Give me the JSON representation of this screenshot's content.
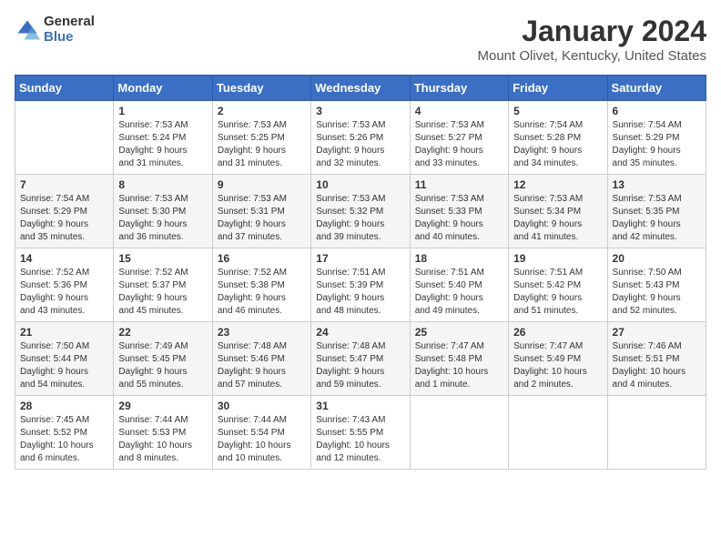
{
  "logo": {
    "general": "General",
    "blue": "Blue"
  },
  "calendar": {
    "title": "January 2024",
    "subtitle": "Mount Olivet, Kentucky, United States"
  },
  "headers": [
    "Sunday",
    "Monday",
    "Tuesday",
    "Wednesday",
    "Thursday",
    "Friday",
    "Saturday"
  ],
  "weeks": [
    [
      {
        "day": "",
        "info": ""
      },
      {
        "day": "1",
        "info": "Sunrise: 7:53 AM\nSunset: 5:24 PM\nDaylight: 9 hours\nand 31 minutes."
      },
      {
        "day": "2",
        "info": "Sunrise: 7:53 AM\nSunset: 5:25 PM\nDaylight: 9 hours\nand 31 minutes."
      },
      {
        "day": "3",
        "info": "Sunrise: 7:53 AM\nSunset: 5:26 PM\nDaylight: 9 hours\nand 32 minutes."
      },
      {
        "day": "4",
        "info": "Sunrise: 7:53 AM\nSunset: 5:27 PM\nDaylight: 9 hours\nand 33 minutes."
      },
      {
        "day": "5",
        "info": "Sunrise: 7:54 AM\nSunset: 5:28 PM\nDaylight: 9 hours\nand 34 minutes."
      },
      {
        "day": "6",
        "info": "Sunrise: 7:54 AM\nSunset: 5:29 PM\nDaylight: 9 hours\nand 35 minutes."
      }
    ],
    [
      {
        "day": "7",
        "info": "Sunrise: 7:54 AM\nSunset: 5:29 PM\nDaylight: 9 hours\nand 35 minutes."
      },
      {
        "day": "8",
        "info": "Sunrise: 7:53 AM\nSunset: 5:30 PM\nDaylight: 9 hours\nand 36 minutes."
      },
      {
        "day": "9",
        "info": "Sunrise: 7:53 AM\nSunset: 5:31 PM\nDaylight: 9 hours\nand 37 minutes."
      },
      {
        "day": "10",
        "info": "Sunrise: 7:53 AM\nSunset: 5:32 PM\nDaylight: 9 hours\nand 39 minutes."
      },
      {
        "day": "11",
        "info": "Sunrise: 7:53 AM\nSunset: 5:33 PM\nDaylight: 9 hours\nand 40 minutes."
      },
      {
        "day": "12",
        "info": "Sunrise: 7:53 AM\nSunset: 5:34 PM\nDaylight: 9 hours\nand 41 minutes."
      },
      {
        "day": "13",
        "info": "Sunrise: 7:53 AM\nSunset: 5:35 PM\nDaylight: 9 hours\nand 42 minutes."
      }
    ],
    [
      {
        "day": "14",
        "info": "Sunrise: 7:52 AM\nSunset: 5:36 PM\nDaylight: 9 hours\nand 43 minutes."
      },
      {
        "day": "15",
        "info": "Sunrise: 7:52 AM\nSunset: 5:37 PM\nDaylight: 9 hours\nand 45 minutes."
      },
      {
        "day": "16",
        "info": "Sunrise: 7:52 AM\nSunset: 5:38 PM\nDaylight: 9 hours\nand 46 minutes."
      },
      {
        "day": "17",
        "info": "Sunrise: 7:51 AM\nSunset: 5:39 PM\nDaylight: 9 hours\nand 48 minutes."
      },
      {
        "day": "18",
        "info": "Sunrise: 7:51 AM\nSunset: 5:40 PM\nDaylight: 9 hours\nand 49 minutes."
      },
      {
        "day": "19",
        "info": "Sunrise: 7:51 AM\nSunset: 5:42 PM\nDaylight: 9 hours\nand 51 minutes."
      },
      {
        "day": "20",
        "info": "Sunrise: 7:50 AM\nSunset: 5:43 PM\nDaylight: 9 hours\nand 52 minutes."
      }
    ],
    [
      {
        "day": "21",
        "info": "Sunrise: 7:50 AM\nSunset: 5:44 PM\nDaylight: 9 hours\nand 54 minutes."
      },
      {
        "day": "22",
        "info": "Sunrise: 7:49 AM\nSunset: 5:45 PM\nDaylight: 9 hours\nand 55 minutes."
      },
      {
        "day": "23",
        "info": "Sunrise: 7:48 AM\nSunset: 5:46 PM\nDaylight: 9 hours\nand 57 minutes."
      },
      {
        "day": "24",
        "info": "Sunrise: 7:48 AM\nSunset: 5:47 PM\nDaylight: 9 hours\nand 59 minutes."
      },
      {
        "day": "25",
        "info": "Sunrise: 7:47 AM\nSunset: 5:48 PM\nDaylight: 10 hours\nand 1 minute."
      },
      {
        "day": "26",
        "info": "Sunrise: 7:47 AM\nSunset: 5:49 PM\nDaylight: 10 hours\nand 2 minutes."
      },
      {
        "day": "27",
        "info": "Sunrise: 7:46 AM\nSunset: 5:51 PM\nDaylight: 10 hours\nand 4 minutes."
      }
    ],
    [
      {
        "day": "28",
        "info": "Sunrise: 7:45 AM\nSunset: 5:52 PM\nDaylight: 10 hours\nand 6 minutes."
      },
      {
        "day": "29",
        "info": "Sunrise: 7:44 AM\nSunset: 5:53 PM\nDaylight: 10 hours\nand 8 minutes."
      },
      {
        "day": "30",
        "info": "Sunrise: 7:44 AM\nSunset: 5:54 PM\nDaylight: 10 hours\nand 10 minutes."
      },
      {
        "day": "31",
        "info": "Sunrise: 7:43 AM\nSunset: 5:55 PM\nDaylight: 10 hours\nand 12 minutes."
      },
      {
        "day": "",
        "info": ""
      },
      {
        "day": "",
        "info": ""
      },
      {
        "day": "",
        "info": ""
      }
    ]
  ]
}
